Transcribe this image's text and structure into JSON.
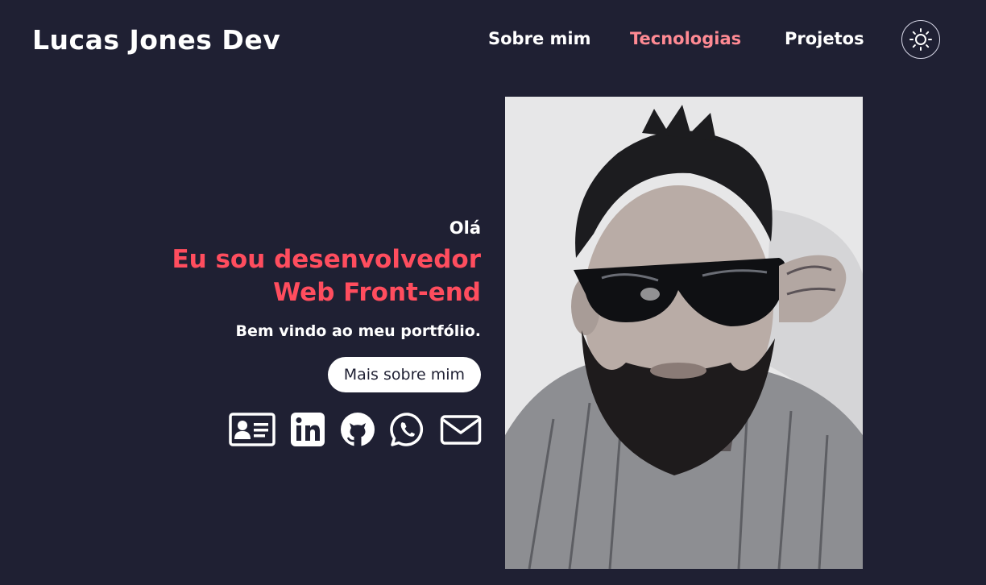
{
  "header": {
    "brand": "Lucas Jones Dev",
    "nav": [
      {
        "label": "Sobre mim",
        "active": false
      },
      {
        "label": "Tecnologias",
        "active": true
      },
      {
        "label": "Projetos",
        "active": false
      }
    ],
    "theme_toggle_icon": "sun-icon"
  },
  "hero": {
    "greeting": "Olá",
    "headline_line1": "Eu sou desenvolvedor",
    "headline_line2": "Web Front-end",
    "welcome": "Bem vindo ao meu portfólio.",
    "cta_label": "Mais sobre mim",
    "socials": [
      "id-card-icon",
      "linkedin-icon",
      "github-icon",
      "whatsapp-icon",
      "mail-icon"
    ],
    "photo_icon": "profile-photo"
  },
  "colors": {
    "background": "#1f2033",
    "accent": "#ff4d5e",
    "nav_active": "#ff8a93",
    "text": "#ffffff"
  }
}
